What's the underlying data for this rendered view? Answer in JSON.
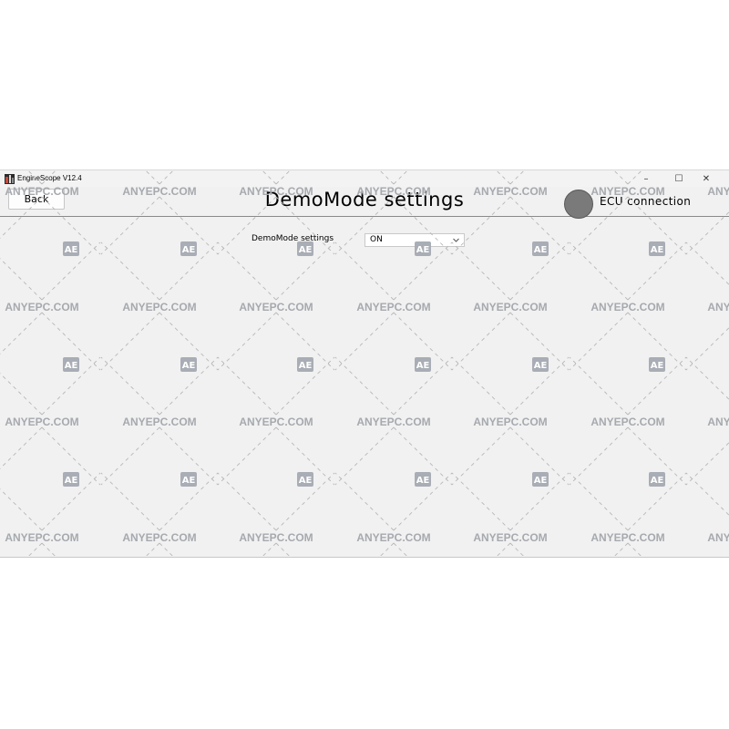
{
  "window": {
    "title": "EngineScope V12.4",
    "controls": {
      "minimize": "–",
      "maximize": "☐",
      "close": "✕"
    }
  },
  "header": {
    "back_label": "Back",
    "page_title": "DemoMode settings",
    "ecu_label": "ECU connection",
    "ecu_status_color": "#7a7a7a"
  },
  "settings": {
    "demomode_label": "DemoMode settings",
    "demomode_value": "ON"
  },
  "watermark": {
    "text": "ANYEPC.COM",
    "badge": "AE"
  }
}
